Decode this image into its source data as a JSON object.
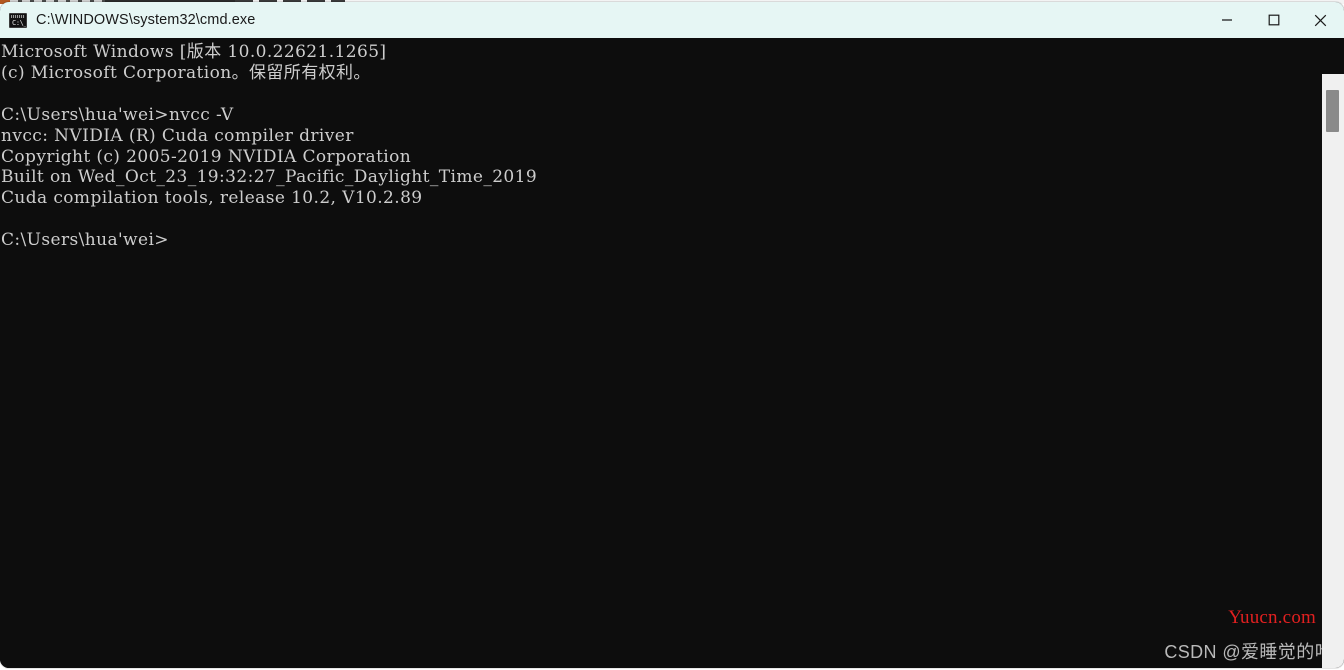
{
  "window": {
    "title": "C:\\WINDOWS\\system32\\cmd.exe",
    "icon": "cmd-console-icon",
    "icon_glyph": "C:\\_",
    "background_color": "#0d0d0d",
    "titlebar_color": "#e6f6f4",
    "text_color": "#cdcdcd"
  },
  "controls": {
    "minimize_label": "Minimize",
    "maximize_label": "Maximize",
    "close_label": "Close"
  },
  "console": {
    "content": "Microsoft Windows [版本 10.0.22621.1265]\n(c) Microsoft Corporation。保留所有权利。\n\nC:\\Users\\hua'wei>nvcc -V\nnvcc: NVIDIA (R) Cuda compiler driver\nCopyright (c) 2005-2019 NVIDIA Corporation\nBuilt on Wed_Oct_23_19:32:27_Pacific_Daylight_Time_2019\nCuda compilation tools, release 10.2, V10.2.89\n\nC:\\Users\\hua'wei>",
    "lines": [
      "Microsoft Windows [版本 10.0.22621.1265]",
      "(c) Microsoft Corporation。保留所有权利。",
      "",
      "C:\\Users\\hua'wei>nvcc -V",
      "nvcc: NVIDIA (R) Cuda compiler driver",
      "Copyright (c) 2005-2019 NVIDIA Corporation",
      "Built on Wed_Oct_23_19:32:27_Pacific_Daylight_Time_2019",
      "Cuda compilation tools, release 10.2, V10.2.89",
      "",
      "C:\\Users\\hua'wei>"
    ],
    "command_entered": "nvcc -V",
    "prompt": "C:\\Users\\hua'wei>"
  },
  "watermarks": {
    "site": "Yuucn.com",
    "site_color": "#e02020",
    "author": "CSDN @爱睡觉的咋",
    "author_color": "#b9b9b9"
  }
}
